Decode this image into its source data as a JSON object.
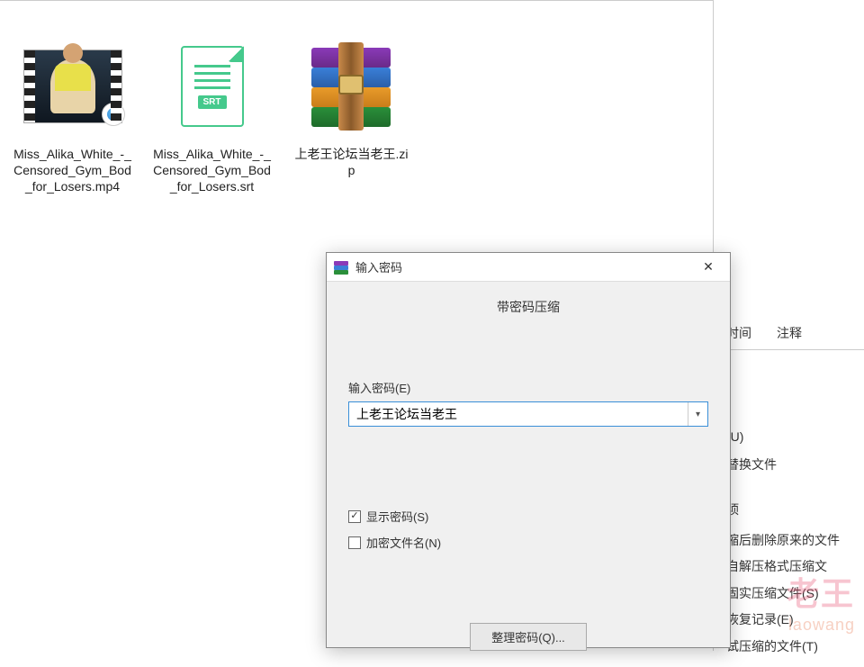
{
  "files": [
    {
      "label": "Miss_Alika_White_-_Censored_Gym_Bod_for_Losers.mp4",
      "type": "video"
    },
    {
      "label": "Miss_Alika_White_-_Censored_Gym_Bod_for_Losers.srt",
      "type": "srt"
    },
    {
      "label": "上老王论坛当老王.zip",
      "type": "zip"
    }
  ],
  "srt_badge": "SRT",
  "dialog": {
    "title": "输入密码",
    "subtitle": "带密码压缩",
    "password_label": "输入密码(E)",
    "password_value": "上老王论坛当老王",
    "show_password_label": "显示密码(S)",
    "show_password_checked": true,
    "encrypt_names_label": "加密文件名(N)",
    "encrypt_names_checked": false,
    "manage_button": "整理密码(Q)...",
    "close_glyph": "✕"
  },
  "background": {
    "tabs": [
      "时间",
      "注释"
    ],
    "option_suffix": "(U)",
    "replace_label": "替换文件",
    "section": "顷",
    "check1": "缩后删除原来的文件",
    "check2": "自解压格式压缩文",
    "check3": "固实压缩文件(S)",
    "check4": "恢复记录(E)",
    "check5": "试压缩的文件(T)"
  },
  "watermark": {
    "main": "老王",
    "sub": "laowang"
  }
}
